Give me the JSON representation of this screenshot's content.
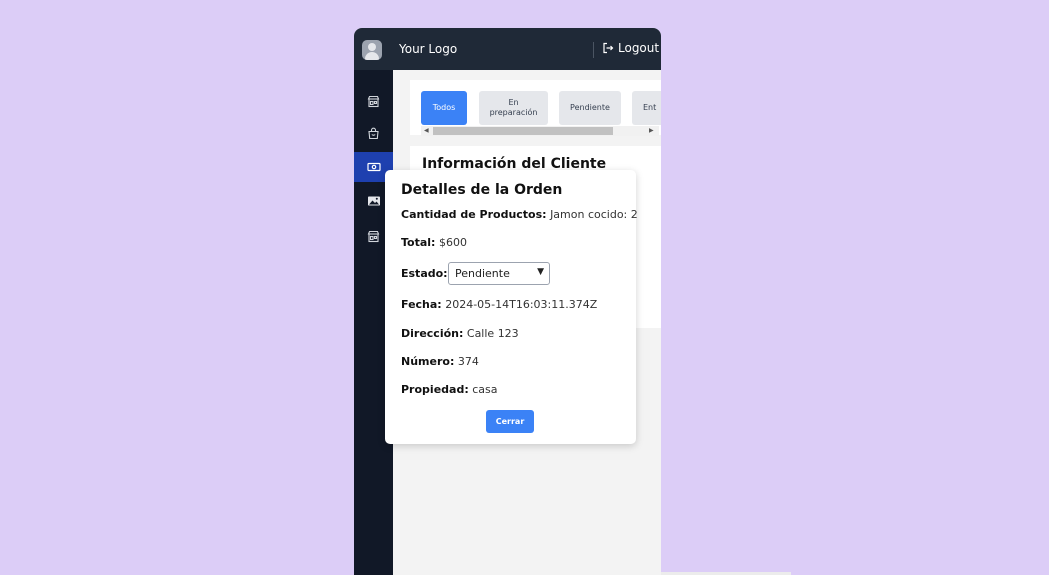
{
  "header": {
    "logo_text": "Your Logo",
    "logout_label": "Logout"
  },
  "sidebar": {
    "items": [
      {
        "icon": "store-icon"
      },
      {
        "icon": "shopping-bag-icon"
      },
      {
        "icon": "money-icon",
        "active": true
      },
      {
        "icon": "image-icon"
      },
      {
        "icon": "store-icon"
      }
    ]
  },
  "tabs": [
    {
      "label": "Todos",
      "active": true
    },
    {
      "label": "En preparación"
    },
    {
      "label": "Pendiente"
    },
    {
      "label": "Ent"
    }
  ],
  "customer_card": {
    "title": "Información del Cliente"
  },
  "modal": {
    "title": "Detalles de la Orden",
    "fields": [
      {
        "label": "Cantidad de Productos:",
        "value": "Jamon cocido: 2"
      },
      {
        "label": "Total:",
        "value": "$600"
      },
      {
        "label": "Estado:",
        "value": "Pendiente"
      },
      {
        "label": "Fecha:",
        "value": "2024-05-14T16:03:11.374Z"
      },
      {
        "label": "Dirección:",
        "value": "Calle 123"
      },
      {
        "label": "Número:",
        "value": "374"
      },
      {
        "label": "Propiedad:",
        "value": "casa"
      }
    ],
    "close_label": "Cerrar"
  },
  "colors": {
    "accent": "#3b82f6",
    "sidebar_active": "#1e40af",
    "topbar": "#1f2937",
    "background": "#dccdf7"
  }
}
